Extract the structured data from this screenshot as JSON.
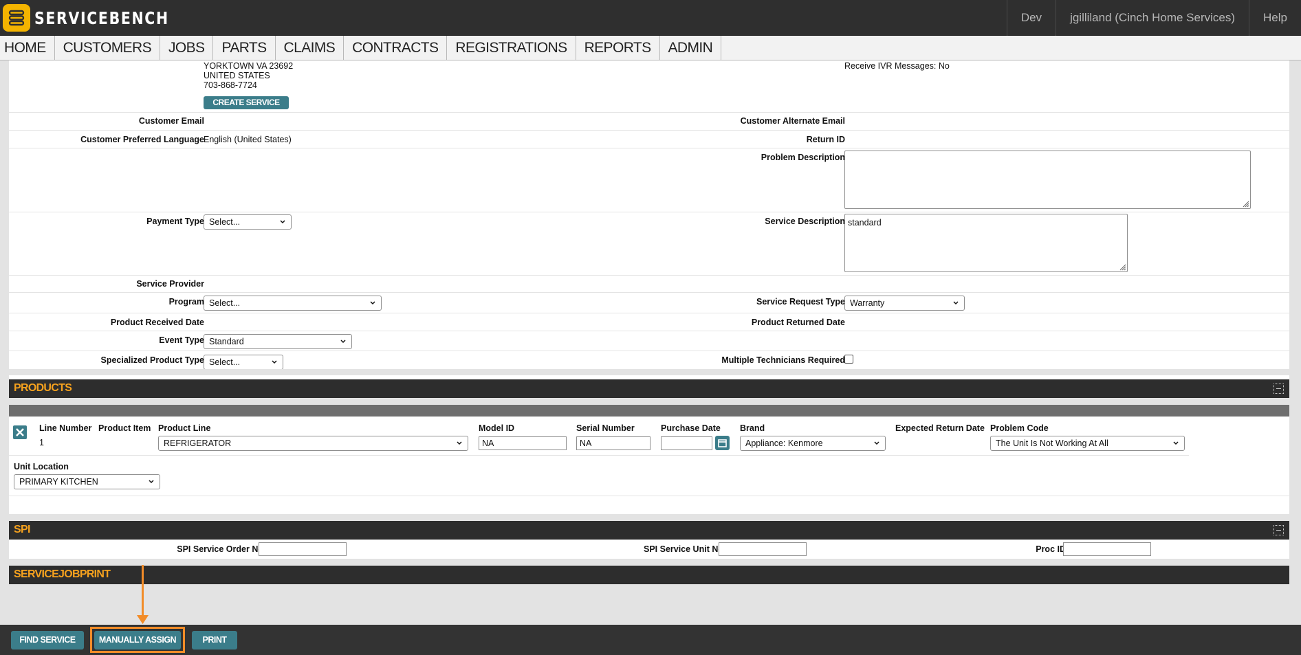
{
  "app": {
    "logo_text": "SERVICEBENCH",
    "top_right": {
      "env": "Dev",
      "user": "jgilliland (Cinch Home Services)",
      "help": "Help"
    }
  },
  "nav": [
    "HOME",
    "CUSTOMERS",
    "JOBS",
    "PARTS",
    "CLAIMS",
    "CONTRACTS",
    "REGISTRATIONS",
    "REPORTS",
    "ADMIN"
  ],
  "customer": {
    "address_line": "YORKTOWN VA 23692",
    "country": "UNITED STATES",
    "phone": "703-868-7724",
    "create_service_order": "CREATE SERVICE ORDER",
    "ivr": "Receive IVR Messages: No",
    "email_label": "Customer Email",
    "alt_email_label": "Customer Alternate Email",
    "language_label": "Customer Preferred Language",
    "language_value": "English (United States)",
    "return_id_label": "Return ID"
  },
  "form": {
    "problem_description_label": "Problem Description",
    "problem_description_value": "",
    "payment_type_label": "Payment Type",
    "payment_type_value": "Select...",
    "service_description_label": "Service Description",
    "service_description_value": "standard",
    "service_provider_label": "Service Provider",
    "program_label": "Program",
    "program_value": "Select...",
    "service_request_type_label": "Service Request Type",
    "service_request_type_value": "Warranty",
    "product_received_date_label": "Product Received Date",
    "product_returned_date_label": "Product Returned Date",
    "event_type_label": "Event Type",
    "event_type_value": "Standard",
    "specialized_product_type_label": "Specialized Product Type",
    "specialized_product_type_value": "Select...",
    "multiple_technicians_label": "Multiple Technicians Required"
  },
  "products": {
    "title": "PRODUCTS",
    "headers": {
      "line_number": "Line Number",
      "product_item": "Product Item",
      "product_line": "Product Line",
      "model_id": "Model ID",
      "serial_number": "Serial Number",
      "purchase_date": "Purchase Date",
      "brand": "Brand",
      "expected_return_date": "Expected Return Date",
      "problem_code": "Problem Code",
      "unit_location": "Unit Location"
    },
    "row": {
      "line_number": "1",
      "product_line": "REFRIGERATOR",
      "model_id": "NA",
      "serial_number": "NA",
      "purchase_date": "",
      "brand": "Appliance: Kenmore",
      "problem_code": "The Unit Is Not Working At All",
      "unit_location": "PRIMARY KITCHEN"
    }
  },
  "spi": {
    "title": "SPI",
    "service_order_no_label": "SPI Service Order No",
    "service_unit_no_label": "SPI Service Unit No",
    "proc_id_label": "Proc ID"
  },
  "servicejobprint": {
    "title": "SERVICEJOBPRINT"
  },
  "footer": {
    "find_service": "FIND SERVICE",
    "manually_assign": "MANUALLY ASSIGN",
    "print": "PRINT"
  },
  "colors": {
    "accent": "#f6a21e",
    "teal": "#3b7d8a",
    "highlight": "#f28c28",
    "dark": "#2d2d2d"
  }
}
